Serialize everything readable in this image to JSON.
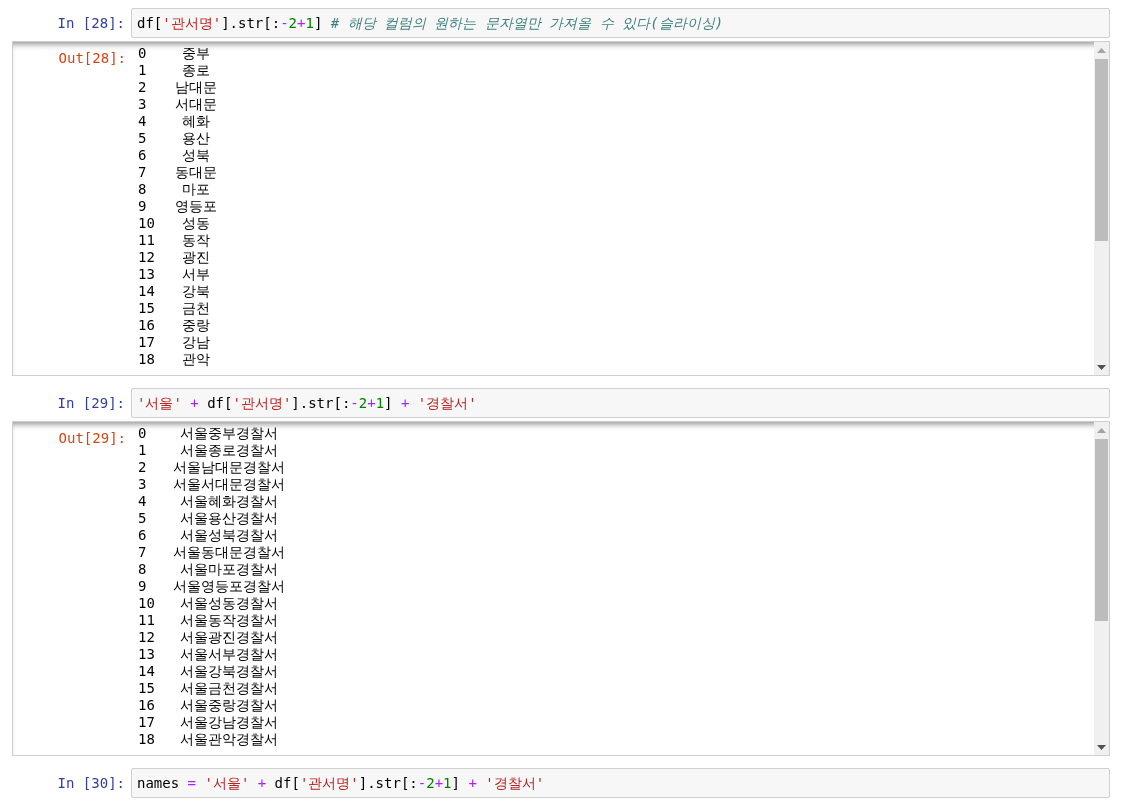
{
  "cells": [
    {
      "input_prompt": "In [28]:",
      "code": [
        {
          "kind": "plain",
          "text": "df["
        },
        {
          "kind": "string",
          "text": "'관서명'"
        },
        {
          "kind": "plain",
          "text": "].str[:"
        },
        {
          "kind": "operator",
          "text": "-"
        },
        {
          "kind": "number",
          "text": "2"
        },
        {
          "kind": "operator",
          "text": "+"
        },
        {
          "kind": "number",
          "text": "1"
        },
        {
          "kind": "plain",
          "text": "] "
        },
        {
          "kind": "comment",
          "text": "# 해당 컬럼의 원하는 문자열만 가져올 수 있다(슬라이싱)"
        }
      ],
      "output": {
        "prompt": "Out[28]:",
        "rows": [
          {
            "index": "0",
            "value": "중부"
          },
          {
            "index": "1",
            "value": "종로"
          },
          {
            "index": "2",
            "value": "남대문"
          },
          {
            "index": "3",
            "value": "서대문"
          },
          {
            "index": "4",
            "value": "혜화"
          },
          {
            "index": "5",
            "value": "용산"
          },
          {
            "index": "6",
            "value": "성북"
          },
          {
            "index": "7",
            "value": "동대문"
          },
          {
            "index": "8",
            "value": "마포"
          },
          {
            "index": "9",
            "value": "영등포"
          },
          {
            "index": "10",
            "value": "성동"
          },
          {
            "index": "11",
            "value": "동작"
          },
          {
            "index": "12",
            "value": "광진"
          },
          {
            "index": "13",
            "value": "서부"
          },
          {
            "index": "14",
            "value": "강북"
          },
          {
            "index": "15",
            "value": "금천"
          },
          {
            "index": "16",
            "value": "중랑"
          },
          {
            "index": "17",
            "value": "강남"
          },
          {
            "index": "18",
            "value": "관악"
          }
        ]
      }
    },
    {
      "input_prompt": "In [29]:",
      "code": [
        {
          "kind": "string",
          "text": "'서울'"
        },
        {
          "kind": "operator",
          "text": " + "
        },
        {
          "kind": "plain",
          "text": "df["
        },
        {
          "kind": "string",
          "text": "'관서명'"
        },
        {
          "kind": "plain",
          "text": "].str[:"
        },
        {
          "kind": "operator",
          "text": "-"
        },
        {
          "kind": "number",
          "text": "2"
        },
        {
          "kind": "operator",
          "text": "+"
        },
        {
          "kind": "number",
          "text": "1"
        },
        {
          "kind": "plain",
          "text": "]"
        },
        {
          "kind": "operator",
          "text": " + "
        },
        {
          "kind": "string",
          "text": "'경찰서'"
        }
      ],
      "output": {
        "prompt": "Out[29]:",
        "rows": [
          {
            "index": "0",
            "value": "서울중부경찰서"
          },
          {
            "index": "1",
            "value": "서울종로경찰서"
          },
          {
            "index": "2",
            "value": "서울남대문경찰서"
          },
          {
            "index": "3",
            "value": "서울서대문경찰서"
          },
          {
            "index": "4",
            "value": "서울혜화경찰서"
          },
          {
            "index": "5",
            "value": "서울용산경찰서"
          },
          {
            "index": "6",
            "value": "서울성북경찰서"
          },
          {
            "index": "7",
            "value": "서울동대문경찰서"
          },
          {
            "index": "8",
            "value": "서울마포경찰서"
          },
          {
            "index": "9",
            "value": "서울영등포경찰서"
          },
          {
            "index": "10",
            "value": "서울성동경찰서"
          },
          {
            "index": "11",
            "value": "서울동작경찰서"
          },
          {
            "index": "12",
            "value": "서울광진경찰서"
          },
          {
            "index": "13",
            "value": "서울서부경찰서"
          },
          {
            "index": "14",
            "value": "서울강북경찰서"
          },
          {
            "index": "15",
            "value": "서울금천경찰서"
          },
          {
            "index": "16",
            "value": "서울중랑경찰서"
          },
          {
            "index": "17",
            "value": "서울강남경찰서"
          },
          {
            "index": "18",
            "value": "서울관악경찰서"
          }
        ]
      }
    },
    {
      "input_prompt": "In [30]:",
      "code": [
        {
          "kind": "plain",
          "text": "names"
        },
        {
          "kind": "operator",
          "text": " = "
        },
        {
          "kind": "string",
          "text": "'서울'"
        },
        {
          "kind": "operator",
          "text": " + "
        },
        {
          "kind": "plain",
          "text": "df["
        },
        {
          "kind": "string",
          "text": "'관서명'"
        },
        {
          "kind": "plain",
          "text": "].str[:"
        },
        {
          "kind": "operator",
          "text": "-"
        },
        {
          "kind": "number",
          "text": "2"
        },
        {
          "kind": "operator",
          "text": "+"
        },
        {
          "kind": "number",
          "text": "1"
        },
        {
          "kind": "plain",
          "text": "]"
        },
        {
          "kind": "operator",
          "text": " + "
        },
        {
          "kind": "string",
          "text": "'경찰서'"
        }
      ]
    }
  ]
}
